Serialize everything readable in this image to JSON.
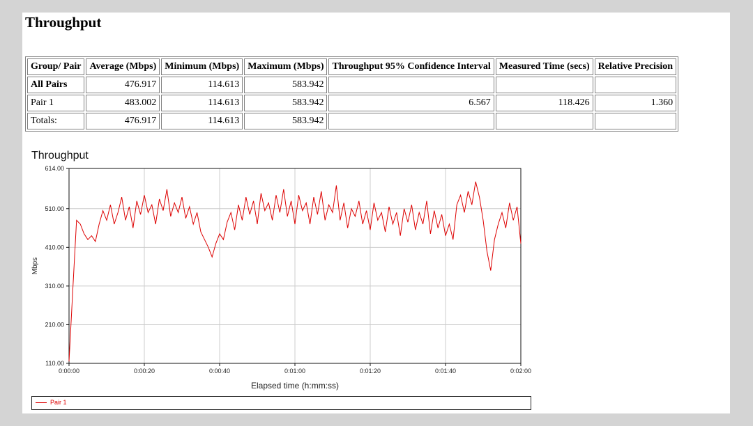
{
  "title": "Throughput",
  "table": {
    "headers": [
      "Group/ Pair",
      "Average (Mbps)",
      "Minimum (Mbps)",
      "Maximum (Mbps)",
      "Throughput 95% Confidence Interval",
      "Measured Time (secs)",
      "Relative Precision"
    ],
    "rows": [
      [
        "All Pairs",
        "476.917",
        "114.613",
        "583.942",
        "",
        "",
        ""
      ],
      [
        "Pair 1",
        "483.002",
        "114.613",
        "583.942",
        "6.567",
        "118.426",
        "1.360"
      ],
      [
        "Totals:",
        "476.917",
        "114.613",
        "583.942",
        "",
        "",
        ""
      ]
    ]
  },
  "chart_data": {
    "type": "line",
    "title": "Throughput",
    "xlabel": "Elapsed time (h:mm:ss)",
    "ylabel": "Mbps",
    "xlim": [
      0,
      120
    ],
    "ylim": [
      110,
      614
    ],
    "xticks": [
      "0:00:00",
      "0:00:20",
      "0:00:40",
      "0:01:00",
      "0:01:20",
      "0:01:40",
      "0:02:00"
    ],
    "yticks": [
      "614.00",
      "510.00",
      "410.00",
      "310.00",
      "210.00",
      "110.00"
    ],
    "ytick_values": [
      614,
      510,
      410,
      310,
      210,
      110
    ],
    "grid": true,
    "legend": "bottom",
    "series": [
      {
        "name": "Pair 1",
        "color": "#dd0000",
        "values": [
          115,
          300,
          480,
          470,
          445,
          430,
          440,
          425,
          470,
          505,
          480,
          520,
          470,
          500,
          540,
          480,
          515,
          460,
          530,
          495,
          545,
          500,
          520,
          470,
          535,
          505,
          560,
          490,
          525,
          500,
          540,
          485,
          515,
          470,
          500,
          450,
          430,
          410,
          385,
          420,
          445,
          430,
          475,
          500,
          455,
          520,
          480,
          540,
          495,
          530,
          470,
          550,
          505,
          525,
          480,
          545,
          500,
          560,
          490,
          530,
          470,
          545,
          505,
          525,
          470,
          540,
          495,
          555,
          480,
          520,
          500,
          570,
          480,
          525,
          460,
          510,
          490,
          530,
          470,
          505,
          455,
          525,
          480,
          500,
          450,
          515,
          470,
          500,
          440,
          510,
          475,
          520,
          455,
          500,
          470,
          530,
          445,
          505,
          460,
          495,
          440,
          470,
          430,
          520,
          545,
          500,
          555,
          520,
          580,
          540,
          480,
          400,
          350,
          430,
          470,
          500,
          460,
          525,
          480,
          515,
          420
        ]
      }
    ]
  }
}
